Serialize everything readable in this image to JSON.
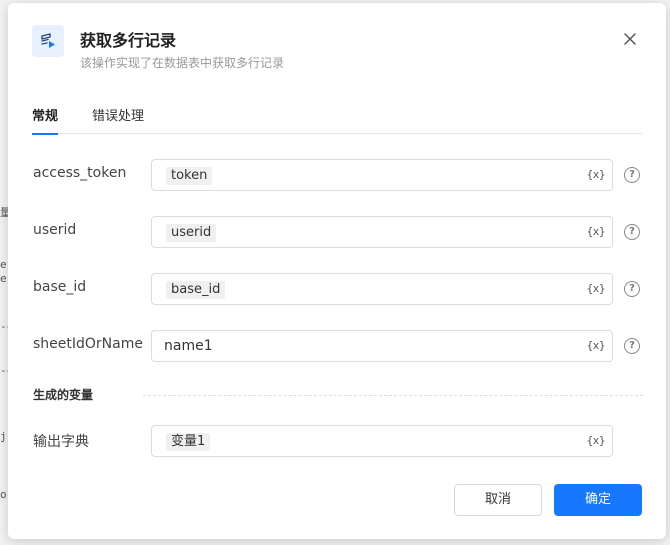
{
  "dialog": {
    "title": "获取多行记录",
    "subtitle": "该操作实现了在数据表中获取多行记录"
  },
  "tabs": [
    {
      "label": "常规",
      "active": true
    },
    {
      "label": "错误处理",
      "active": false
    }
  ],
  "fields": {
    "access_token": {
      "label": "access_token",
      "value": "token"
    },
    "userid": {
      "label": "userid",
      "value": "userid"
    },
    "base_id": {
      "label": "base_id",
      "value": "base_id"
    },
    "sheet": {
      "label": "sheetIdOrName",
      "value": "name1"
    }
  },
  "variable_button": "{x}",
  "help_glyph": "?",
  "output": {
    "section_title": "生成的变量",
    "label": "输出字典",
    "value": "变量1"
  },
  "buttons": {
    "cancel": "取消",
    "ok": "确定"
  },
  "colors": {
    "primary": "#1677ff"
  }
}
